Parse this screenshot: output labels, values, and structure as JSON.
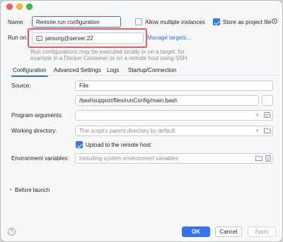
{
  "dialog": {
    "name_label": "Name:",
    "name_value": "Remote run configuration",
    "allow_multiple_label": "Allow multiple instances",
    "store_label": "Store as project file",
    "run_on_label": "Run on:",
    "run_on_value": "jansorg@server:22",
    "manage_targets": "Manage targets...",
    "hint_line1": "Run configurations may be executed locally or on a target: for",
    "hint_line2": "example in a Docker Container or on a remote host using SSH."
  },
  "tabs": [
    {
      "label": "Configuration"
    },
    {
      "label": "Advanced Settings"
    },
    {
      "label": "Logs"
    },
    {
      "label": "Startup/Connection"
    }
  ],
  "form": {
    "source_label": "Source:",
    "source_value": "File",
    "file_path": "/bashsupport/files/runConfig/main.bash",
    "program_args_label": "Program arguments:",
    "working_dir_label": "Working directory:",
    "working_dir_placeholder": "The script's parent directory by default",
    "upload_label": "Upload to the remote host",
    "env_label": "Environment variables:",
    "env_placeholder": "Including system environment variables",
    "before_launch": "Before launch"
  },
  "buttons": {
    "help": "?",
    "ok": "OK",
    "cancel": "Cancel",
    "apply": "Apply"
  },
  "colors": {
    "accent": "#3574f0",
    "highlight_box": "#ee5a5a"
  }
}
